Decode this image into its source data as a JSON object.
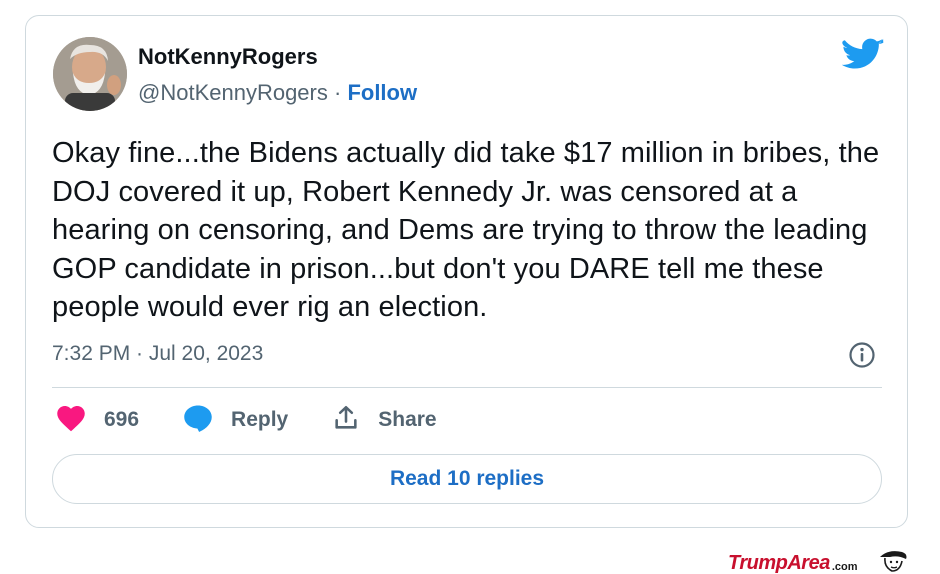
{
  "tweet": {
    "display_name": "NotKennyRogers",
    "handle": "@NotKennyRogers",
    "separator": " · ",
    "follow_label": "Follow",
    "text": "Okay fine...the Bidens actually did take $17 million in bribes, the DOJ covered it up, Robert Kennedy Jr. was censored at a hearing on censoring, and Dems are trying to throw the leading GOP candidate in prison...but don't you DARE tell me these people would ever rig an election.",
    "timestamp": "7:32 PM · Jul 20, 2023",
    "likes_count": "696",
    "reply_label": "Reply",
    "share_label": "Share",
    "read_replies_label": "Read 10 replies"
  },
  "watermark": {
    "brand": "TrumpArea",
    "suffix": ".com"
  },
  "colors": {
    "twitter_blue": "#1d9bf0",
    "link_blue": "#1d6ec5",
    "heart_pink": "#f91880",
    "watermark_red": "#c8102e",
    "text_dark": "#0f1419",
    "text_gray": "#536471"
  },
  "icons": {
    "brand": "twitter-bird-icon",
    "info": "info-icon",
    "like": "heart-icon",
    "reply": "speech-bubble-icon",
    "share": "share-upload-icon",
    "watermark": "trump-caricature-icon"
  }
}
